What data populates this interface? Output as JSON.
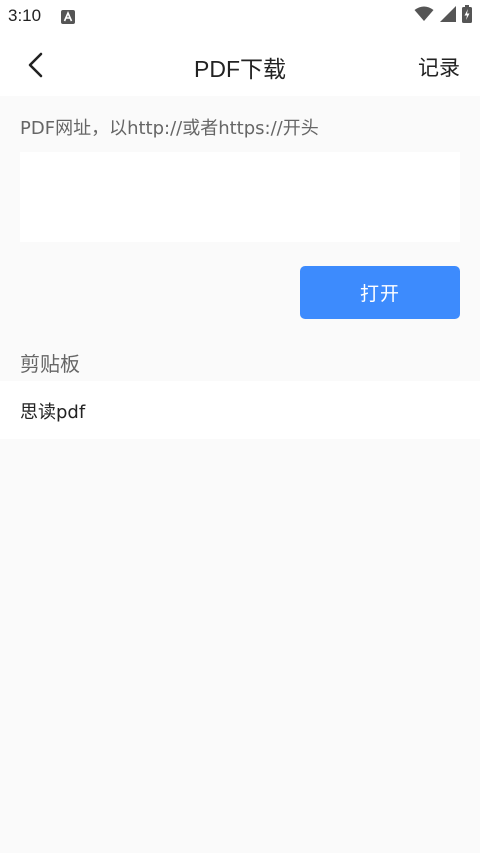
{
  "status_bar": {
    "time": "3:10",
    "notification_icon": "a-letter-icon",
    "wifi_icon": "wifi-icon",
    "signal_icon": "signal-icon",
    "battery_icon": "battery-charging-icon"
  },
  "app_bar": {
    "back_icon": "chevron-left-icon",
    "title": "PDF下载",
    "record_label": "记录"
  },
  "form": {
    "url_label": "PDF网址，以http://或者https://开头",
    "url_value": "",
    "open_button_label": "打开"
  },
  "clipboard": {
    "heading": "剪贴板",
    "items": [
      {
        "text": "思读pdf"
      }
    ]
  },
  "colors": {
    "accent": "#3d8bfd",
    "background": "#fafafa",
    "surface": "#ffffff",
    "secondary_text": "#666666",
    "primary_text": "#222222"
  }
}
